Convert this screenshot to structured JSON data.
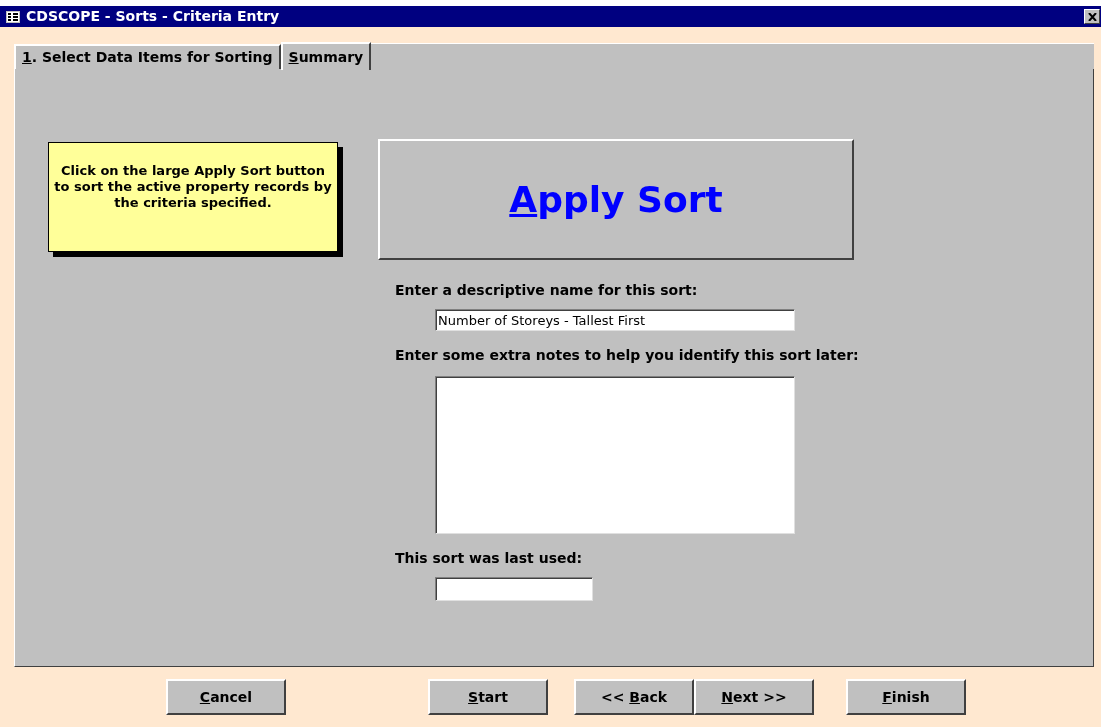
{
  "window": {
    "title": "CDSCOPE - Sorts - Criteria Entry"
  },
  "tabs": [
    {
      "label": "1. Select Data Items for Sorting",
      "selected": false
    },
    {
      "label": "Summary",
      "selected": true
    }
  ],
  "note": {
    "text": "Click on the large Apply Sort button to sort the active property records by the criteria specified."
  },
  "apply_button": {
    "label": "Apply Sort"
  },
  "fields": [
    {
      "label": "Enter a descriptive name for this sort:",
      "kind": "text",
      "value": "Number of Storeys - Tallest First"
    },
    {
      "label": "Enter some extra notes to help you identify this sort later:",
      "kind": "memo"
    },
    {
      "label": "This sort was last used:",
      "kind": "short"
    }
  ],
  "buttons": [
    {
      "label": "Cancel"
    },
    {
      "label": "Start"
    },
    {
      "label": "<< Back"
    },
    {
      "label": "Next >>"
    },
    {
      "label": "Finish"
    }
  ]
}
